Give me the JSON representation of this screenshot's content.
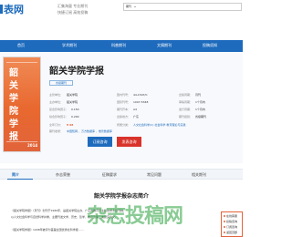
{
  "header": {
    "logo_text": "表网",
    "slogan_line1": "汇集海量  专业期刊",
    "slogan_line2": "快捷订阅  高效投稿",
    "search_type": "期刊",
    "search_placeholder": ""
  },
  "nav": {
    "items": [
      "首页",
      "学术期刊",
      "科普期刊",
      "文摘期刊",
      "投稿须知"
    ]
  },
  "journal": {
    "title": "韶关学院学报",
    "tag": "省级期刊",
    "cover_chars": [
      "韶",
      "关",
      "学",
      "院",
      "学",
      "报"
    ],
    "cover_year": "2014",
    "info": [
      {
        "label": "主管单位：",
        "value": "韶关学院"
      },
      {
        "label": "主办单位：",
        "value": "韶关学院"
      },
      {
        "label": "国际刊号：",
        "value": "1007-5348"
      },
      {
        "label": "国内刊号：",
        "value": "44-1507/C"
      },
      {
        "label": "出版周期：",
        "value": "月刊"
      },
      {
        "label": "复合影响因子：",
        "value": "0.150"
      },
      {
        "label": "综合影响因子：",
        "value": "0.200"
      },
      {
        "label": "出版地方：",
        "value": "广东"
      },
      {
        "label": "期刊开本：",
        "value": "A4"
      },
      {
        "label": "发行周期：",
        "value": "1个月内"
      },
      {
        "label": "审稿周期：",
        "value": "1个月内"
      },
      {
        "label": "期刊级别：",
        "value": "省级期刊"
      }
    ],
    "price_label": "全年订价：",
    "price_value": "¥ 98",
    "category_label": "所属分类：",
    "category_value": "人文社会科学(C)  社会科学  教育理论与实践",
    "database_label": "期刊收录：",
    "database_value": "中国知网 、万方数据库 、维普数据库",
    "subscribe_label": "订阅咨询",
    "publish_label": "发表咨询"
  },
  "tabs": [
    "简介",
    "杂志荣誉",
    "征稿要求",
    "常见问题",
    "相关期刊"
  ],
  "intro": {
    "title": "韶关学院学报杂志简介",
    "lines": [
      "《韶关学院学报》（月刊）创刊于1980年，是韶关学院主办、广东省教育厅主管的学术性刊物，",
      "以人文社会科学与自然科学并重，主要刊发文学、历史、哲学、教育及理工类研究论文。",
      "《韶关学院学报》1998年被评为首届全国优秀社科学报……"
    ]
  },
  "watermark": "杂志投稿网",
  "side_panel": {
    "items": [
      "在线客服",
      "投稿咨询",
      "订阅咨询",
      "返回顶部"
    ]
  }
}
